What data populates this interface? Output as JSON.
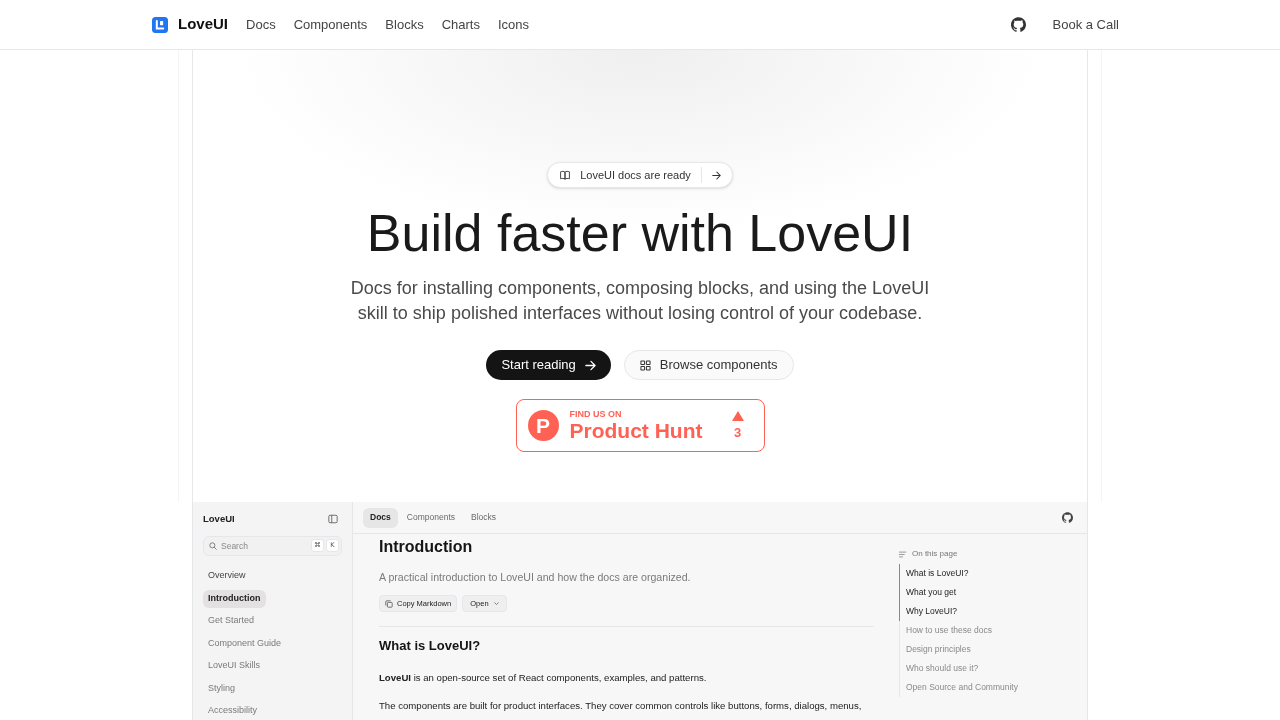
{
  "nav": {
    "brand": "LoveUI",
    "links": [
      "Docs",
      "Components",
      "Blocks",
      "Charts",
      "Icons"
    ],
    "cta": "Book a Call"
  },
  "hero": {
    "announcement": "LoveUI docs are ready",
    "title": "Build faster with LoveUI",
    "description": "Docs for installing components, composing blocks, and using the LoveUI skill to ship polished interfaces without losing control of your codebase.",
    "buttons": [
      {
        "label": "Start reading",
        "kind": "primary"
      },
      {
        "label": "Browse components",
        "kind": "secondary"
      }
    ],
    "product_hunt": {
      "logo": "P",
      "eyebrow": "FIND US ON",
      "name": "Product Hunt",
      "count": "3"
    }
  },
  "preview": {
    "sidebar": {
      "title": "LoveUI",
      "search": {
        "placeholder": "Search",
        "keys": [
          "⌘",
          "K"
        ]
      },
      "items": [
        {
          "label": "Overview",
          "kind": "heading",
          "selected": false
        },
        {
          "label": "Introduction",
          "kind": "link",
          "selected": true
        },
        {
          "label": "Get Started",
          "kind": "link",
          "selected": false
        },
        {
          "label": "Component Guide",
          "kind": "link",
          "selected": false
        },
        {
          "label": "LoveUI Skills",
          "kind": "link",
          "selected": false
        },
        {
          "label": "Styling",
          "kind": "link",
          "selected": false
        },
        {
          "label": "Accessibility",
          "kind": "link",
          "selected": false
        }
      ]
    },
    "tabs": [
      {
        "label": "Docs",
        "selected": true
      },
      {
        "label": "Components",
        "selected": false
      },
      {
        "label": "Blocks",
        "selected": false
      }
    ],
    "article": {
      "title": "Introduction",
      "subtitle": "A practical introduction to LoveUI and how the docs are organized.",
      "actions": [
        {
          "label": "Copy Markdown",
          "kind": "copy"
        },
        {
          "label": "Open",
          "kind": "menu"
        }
      ],
      "sections": [
        {
          "heading": "What is LoveUI?",
          "paragraphs": [
            "**LoveUI** is an open-source set of React components, examples, and patterns.",
            "The components are built for product interfaces. They cover common controls like buttons, forms, dialogs, menus,"
          ]
        }
      ]
    },
    "toc": {
      "title": "On this page",
      "items": [
        {
          "label": "What is LoveUI?",
          "active": true
        },
        {
          "label": "What you get",
          "active": true
        },
        {
          "label": "Why LoveUI?",
          "active": true
        },
        {
          "label": "How to use these docs",
          "active": false
        },
        {
          "label": "Design principles",
          "active": false
        },
        {
          "label": "Who should use it?",
          "active": false
        },
        {
          "label": "Open Source and Community",
          "active": false
        }
      ]
    }
  }
}
